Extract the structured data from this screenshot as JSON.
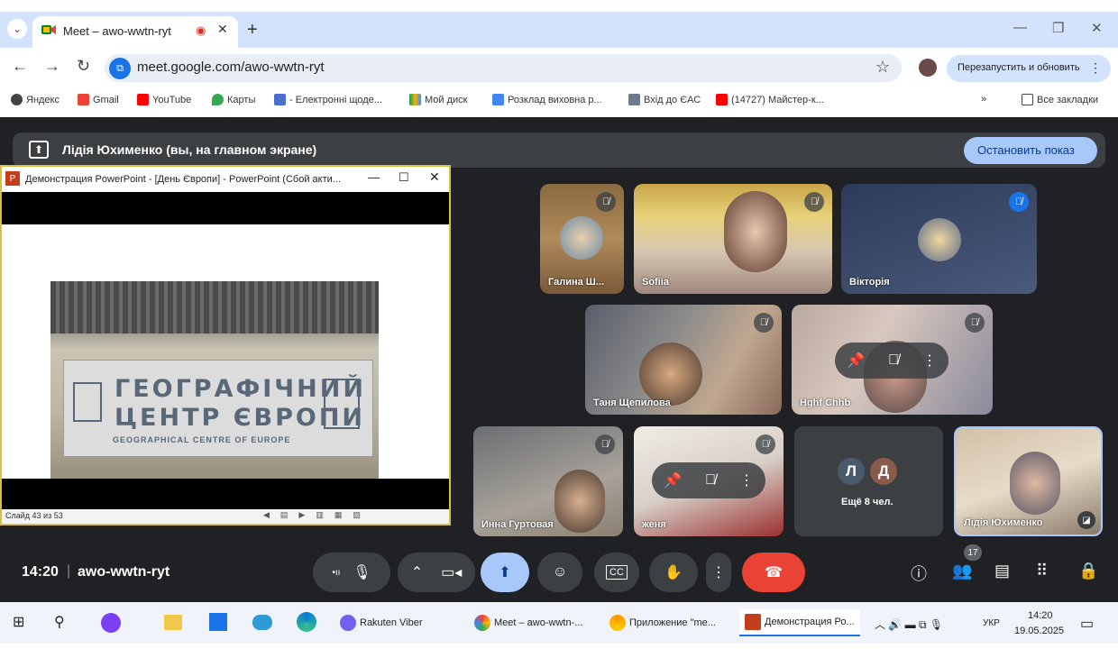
{
  "browser": {
    "tab_title": "Meet – awo-wwtn-ryt",
    "url": "meet.google.com/awo-wwtn-ryt",
    "restart_label": "Перезапустить и обновить",
    "bookmarks": [
      "Яндекс",
      "Gmail",
      "YouTube",
      "Карты",
      "- Електронні щоде...",
      "Мой диск",
      "Розклад виховна р...",
      "Вхід до ЄАС",
      "(14727) Майстер-к..."
    ],
    "all_bookmarks": "Все закладки"
  },
  "meet": {
    "presenting_label": "Лідія Юхименко (вы, на главном экране)",
    "stop_label": "Остановить показ",
    "time": "14:20",
    "meeting_code": "awo-wwtn-ryt",
    "people_count": "17",
    "participants": [
      "Галина Ш...",
      "Sofiia",
      "Вікторія",
      "Таня Щепилова",
      "Hghf Chhb",
      "Инна Гуртовая",
      "женя",
      "Лідія Юхименко"
    ],
    "more": {
      "initials": [
        "Л",
        "Д"
      ],
      "label": "Ещё 8 чел."
    }
  },
  "ppt": {
    "window_title": "Демонстрация PowerPoint - [День Європи] - PowerPoint (Сбой акти...",
    "slide_status": "Слайд 43 из 53",
    "sign_line1": "ГЕОГРАФІЧНИЙ",
    "sign_line2": "ЦЕНТР ЄВРОПИ",
    "sign_line3": "GEOGRAPHICAL CENTRE OF EUROPE"
  },
  "taskbar": {
    "apps": [
      "Rakuten Viber",
      "Meet – awo-wwtn-...",
      "Приложение \"me...",
      "Демонстрация Ро..."
    ],
    "lang": "УКР",
    "time": "14:20",
    "date": "19.05.2025"
  },
  "colors": {
    "accent": "#1a73e8",
    "meet_bg": "#202124",
    "end_call": "#ea4335",
    "stop_btn": "#a8c7fa"
  }
}
